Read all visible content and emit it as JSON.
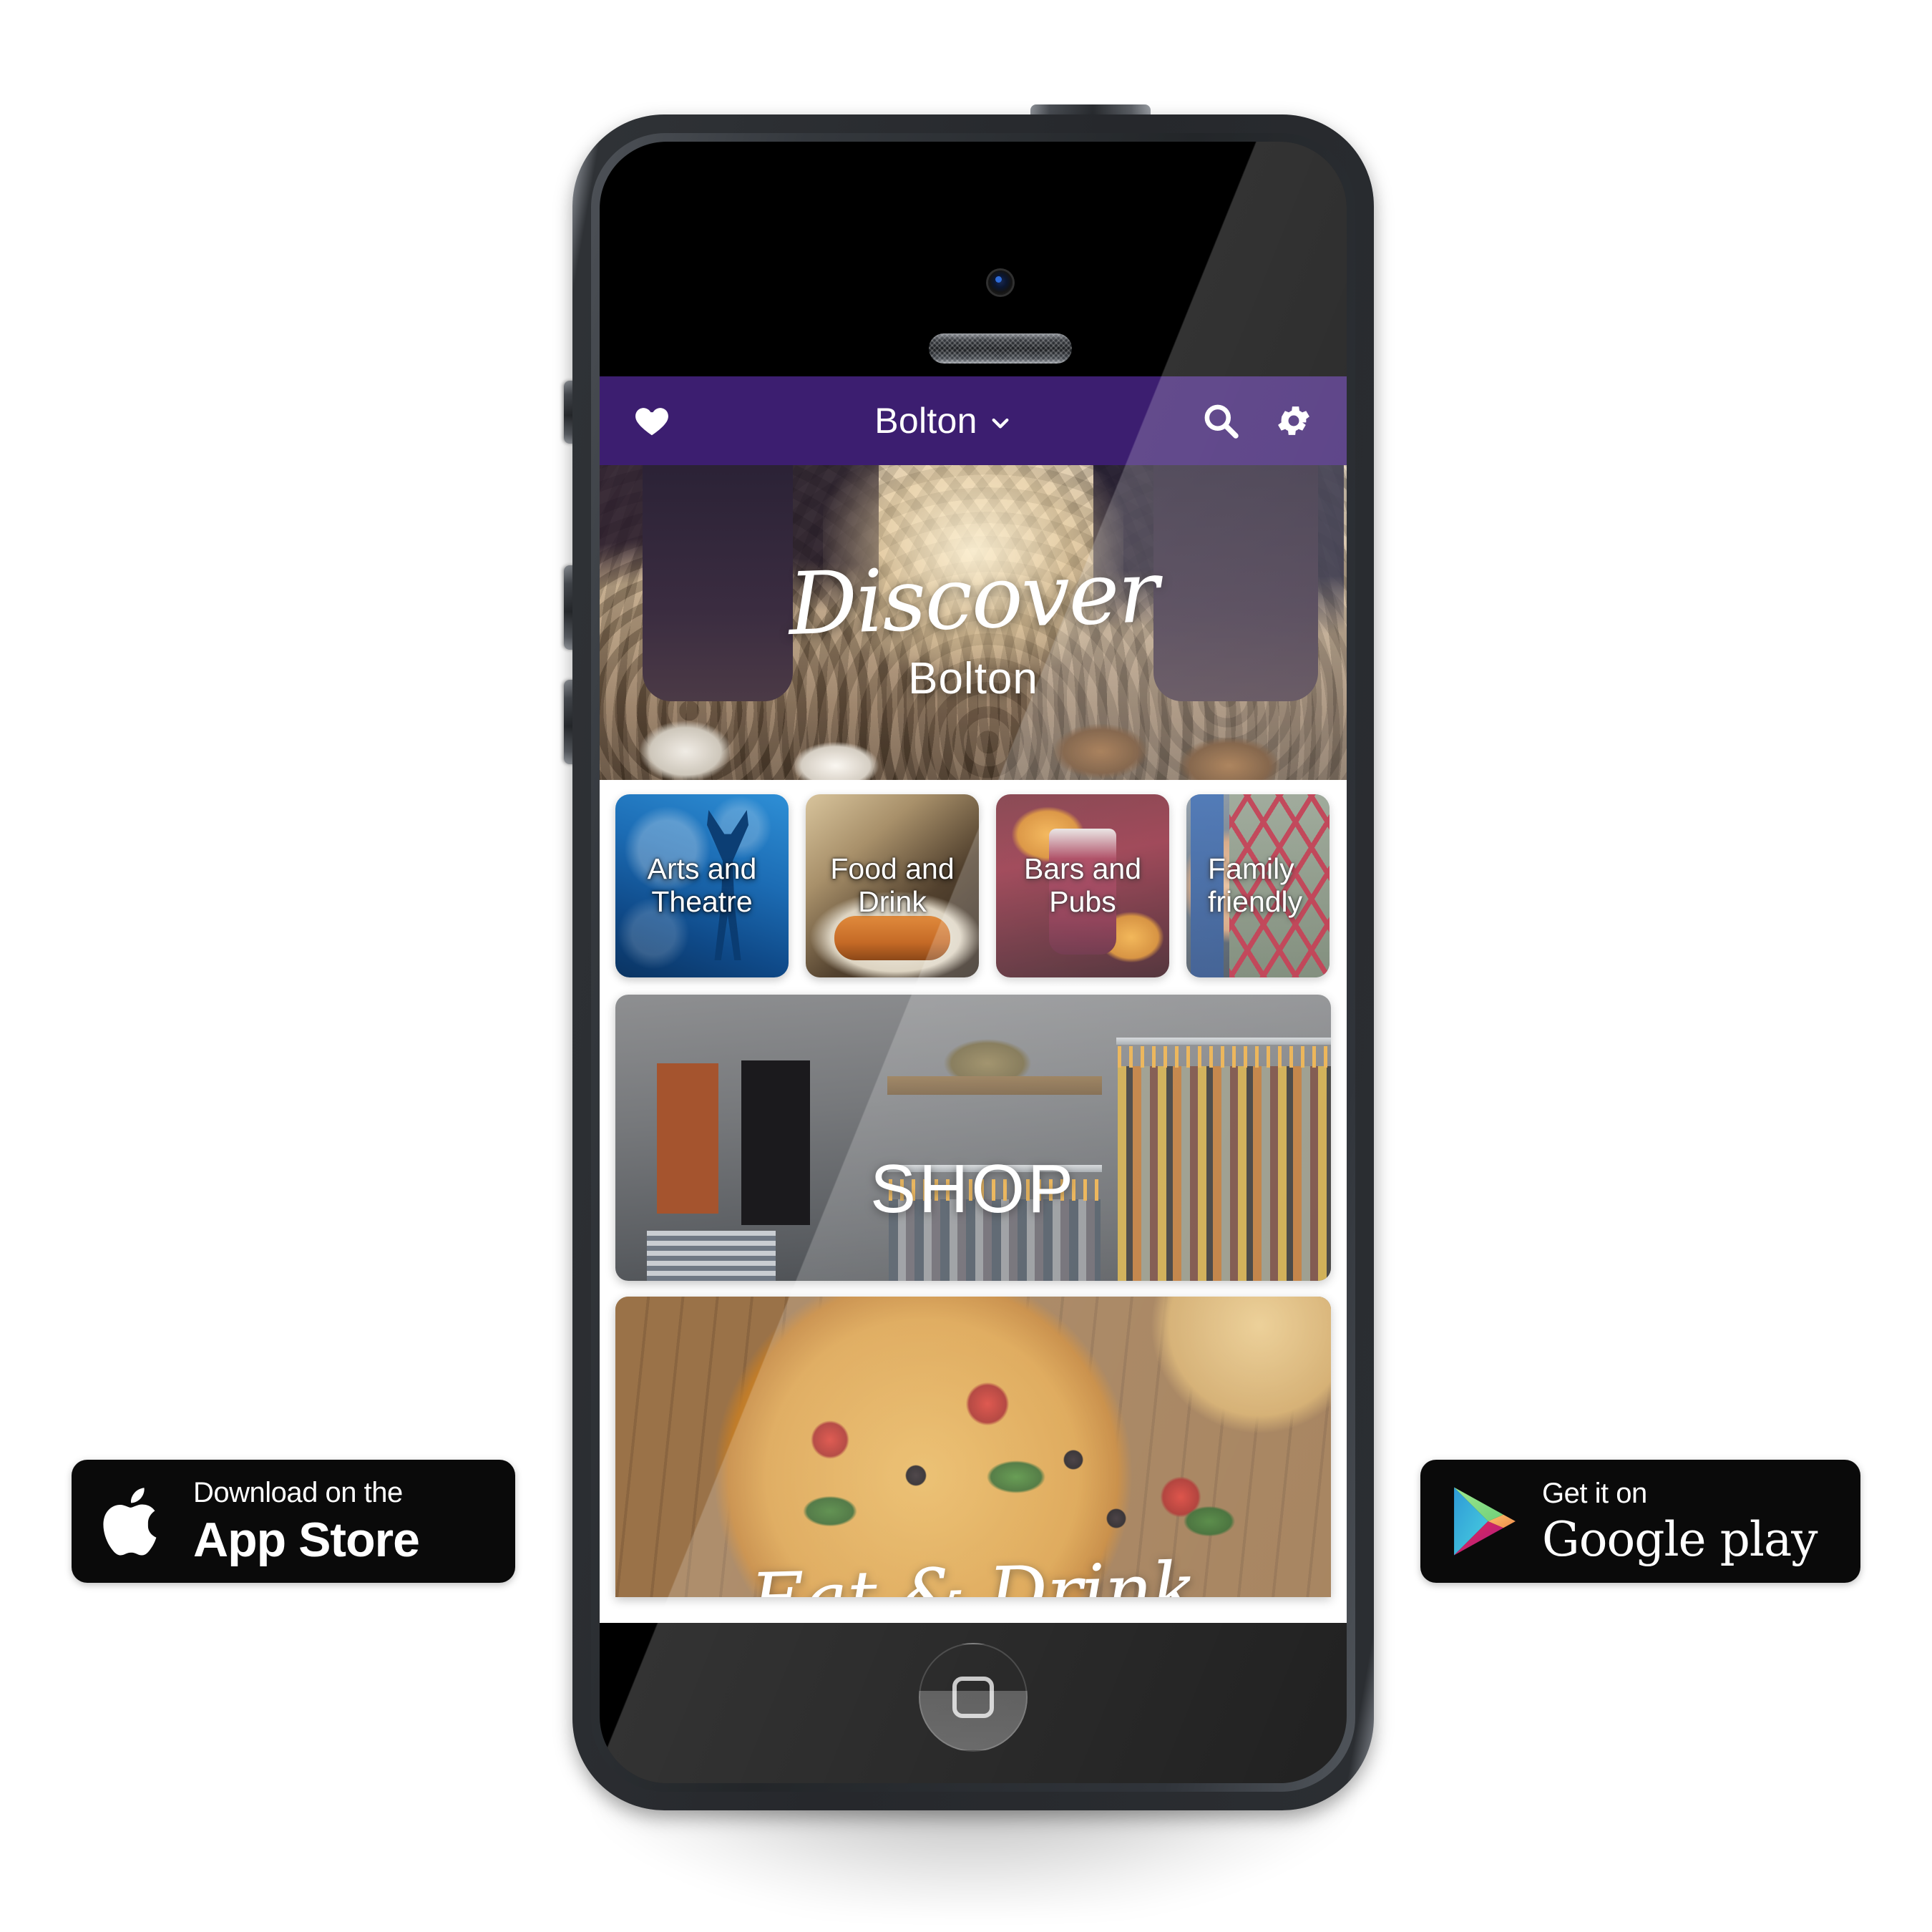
{
  "device": {
    "type": "smartphone-mockup",
    "hardware": {
      "mute_switch": "mute-switch",
      "volume_up": "volume-up",
      "volume_down": "volume-down",
      "power_button": "power-button",
      "home_button": "home-button",
      "front_camera": "front-camera",
      "earpiece_speaker": "earpiece-speaker"
    }
  },
  "colors": {
    "header_purple": "#3C1E70",
    "app_background": "#FFFFFF",
    "badge_black": "#0A0A0A",
    "text_white": "#FFFFFF"
  },
  "app": {
    "header": {
      "favourites_icon": "heart-icon",
      "city": "Bolton",
      "city_dropdown_icon": "chevron-down-icon",
      "search_icon": "search-icon",
      "settings_icon": "gear-icon"
    },
    "hero": {
      "title": "Discover",
      "subtitle": "Bolton",
      "image_alt": "people-walking-cobbled-street"
    },
    "categories": [
      {
        "label": "Arts and Theatre",
        "image_alt": "dancer-silhouette-blue"
      },
      {
        "label": "Food and Drink",
        "image_alt": "salmon-salad-plate"
      },
      {
        "label": "Bars and Pubs",
        "image_alt": "cocktail-with-orange-slices"
      },
      {
        "label": "Family friendly",
        "image_alt": "child-on-playground"
      }
    ],
    "cards": [
      {
        "label": "SHOP",
        "image_alt": "clothing-rails-boutique"
      },
      {
        "label": "Eat & Drink",
        "image_alt": "pizza-on-wooden-table"
      }
    ]
  },
  "store_badges": {
    "apple": {
      "icon": "apple-logo-icon",
      "sub_label": "Download on the",
      "main_label": "App Store"
    },
    "google": {
      "icon": "google-play-triangle-icon",
      "sub_label": "Get it on",
      "main_label": "Google play"
    }
  }
}
